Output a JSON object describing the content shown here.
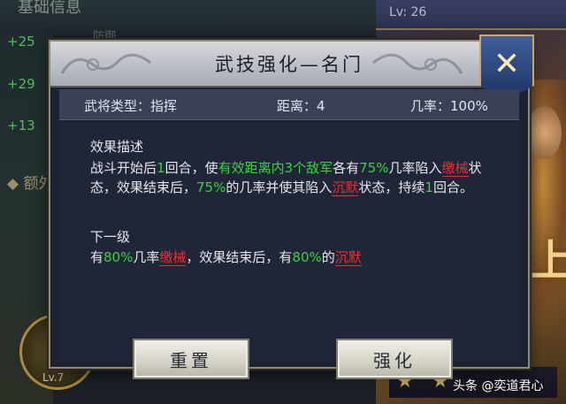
{
  "background": {
    "header_text": "基础信息",
    "header_right": "防御",
    "stats": [
      "+25",
      "+29",
      "+13"
    ],
    "extra_label": "额外",
    "level_label": "Lv: 26",
    "big_char": "上",
    "orb_label": "Lv.7"
  },
  "dialog": {
    "title": "武技强化—名门",
    "close_icon": "close-x-icon",
    "info": {
      "type_text": "武将类型：指挥",
      "range_text": "距离：4",
      "rate_text": "几率：100%"
    },
    "effect": {
      "heading": "效果描述",
      "segments": [
        {
          "t": "战斗开始后",
          "c": "n"
        },
        {
          "t": "1",
          "c": "g"
        },
        {
          "t": "回合，使",
          "c": "n"
        },
        {
          "t": "有效距离内3个敌军",
          "c": "g"
        },
        {
          "t": "各有",
          "c": "n"
        },
        {
          "t": "75%",
          "c": "g"
        },
        {
          "t": "几率陷入",
          "c": "n"
        },
        {
          "t": "缴械",
          "c": "r"
        },
        {
          "t": "状态，效果结束后，",
          "c": "n"
        },
        {
          "t": "75%",
          "c": "g"
        },
        {
          "t": "的几率并使其陷入",
          "c": "n"
        },
        {
          "t": "沉默",
          "c": "r"
        },
        {
          "t": "状态，持续",
          "c": "n"
        },
        {
          "t": "1",
          "c": "g"
        },
        {
          "t": "回合。",
          "c": "n"
        }
      ]
    },
    "next_level": {
      "heading": "下一级",
      "segments": [
        {
          "t": "有",
          "c": "n"
        },
        {
          "t": "80%",
          "c": "g"
        },
        {
          "t": "几率",
          "c": "n"
        },
        {
          "t": "缴械",
          "c": "r"
        },
        {
          "t": "，效果结束后，有",
          "c": "n"
        },
        {
          "t": "80%",
          "c": "g"
        },
        {
          "t": "的",
          "c": "n"
        },
        {
          "t": "沉默",
          "c": "r"
        }
      ]
    },
    "buttons": {
      "reset_label": "重置",
      "enhance_label": "强化"
    }
  },
  "watermark": "头条 @奕道君心",
  "colors": {
    "highlight_green": "#36d43d",
    "highlight_red": "#ea3030",
    "header_silver": "#bfc1c9",
    "close_blue": "#2c4680",
    "panel_dark": "#202637"
  }
}
